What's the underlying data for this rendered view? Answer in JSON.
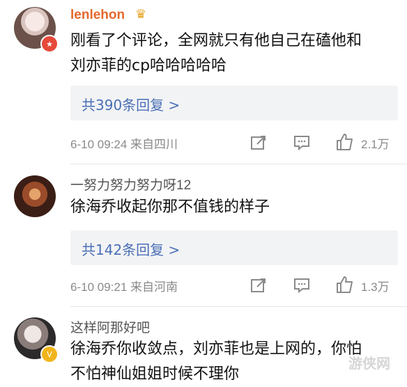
{
  "comments": [
    {
      "username": "lenlehon",
      "text_line1": "刚看了个评论，全网就只有他自己在磕他和",
      "text_line2": "刘亦菲的cp哈哈哈哈哈",
      "reply_label": "共390条回复 >",
      "meta": "6-10 09:24  来自四川",
      "likes": "2.1万",
      "verify_icon": "red-badge",
      "name_icon": "crown-icon"
    },
    {
      "username": "一努力努力努力呀12",
      "text_line1": "徐海乔收起你那不值钱的样子",
      "reply_label": "共142条回复 >",
      "meta": "6-10 09:21  来自河南",
      "likes": "1.3万"
    },
    {
      "username": "这样阿那好吧",
      "text_line1": "徐海乔你收敛点，刘亦菲也是上网的，你怕",
      "text_line2": "不怕神仙姐姐时候不理你",
      "verify_icon": "gold-v-badge"
    }
  ],
  "watermark": "游侠网",
  "colors": {
    "username_vip": "#e4682d",
    "reply_link": "#4a6fb6",
    "meta_gray": "#8a8a8a",
    "reply_bg": "#f2f3f5"
  }
}
